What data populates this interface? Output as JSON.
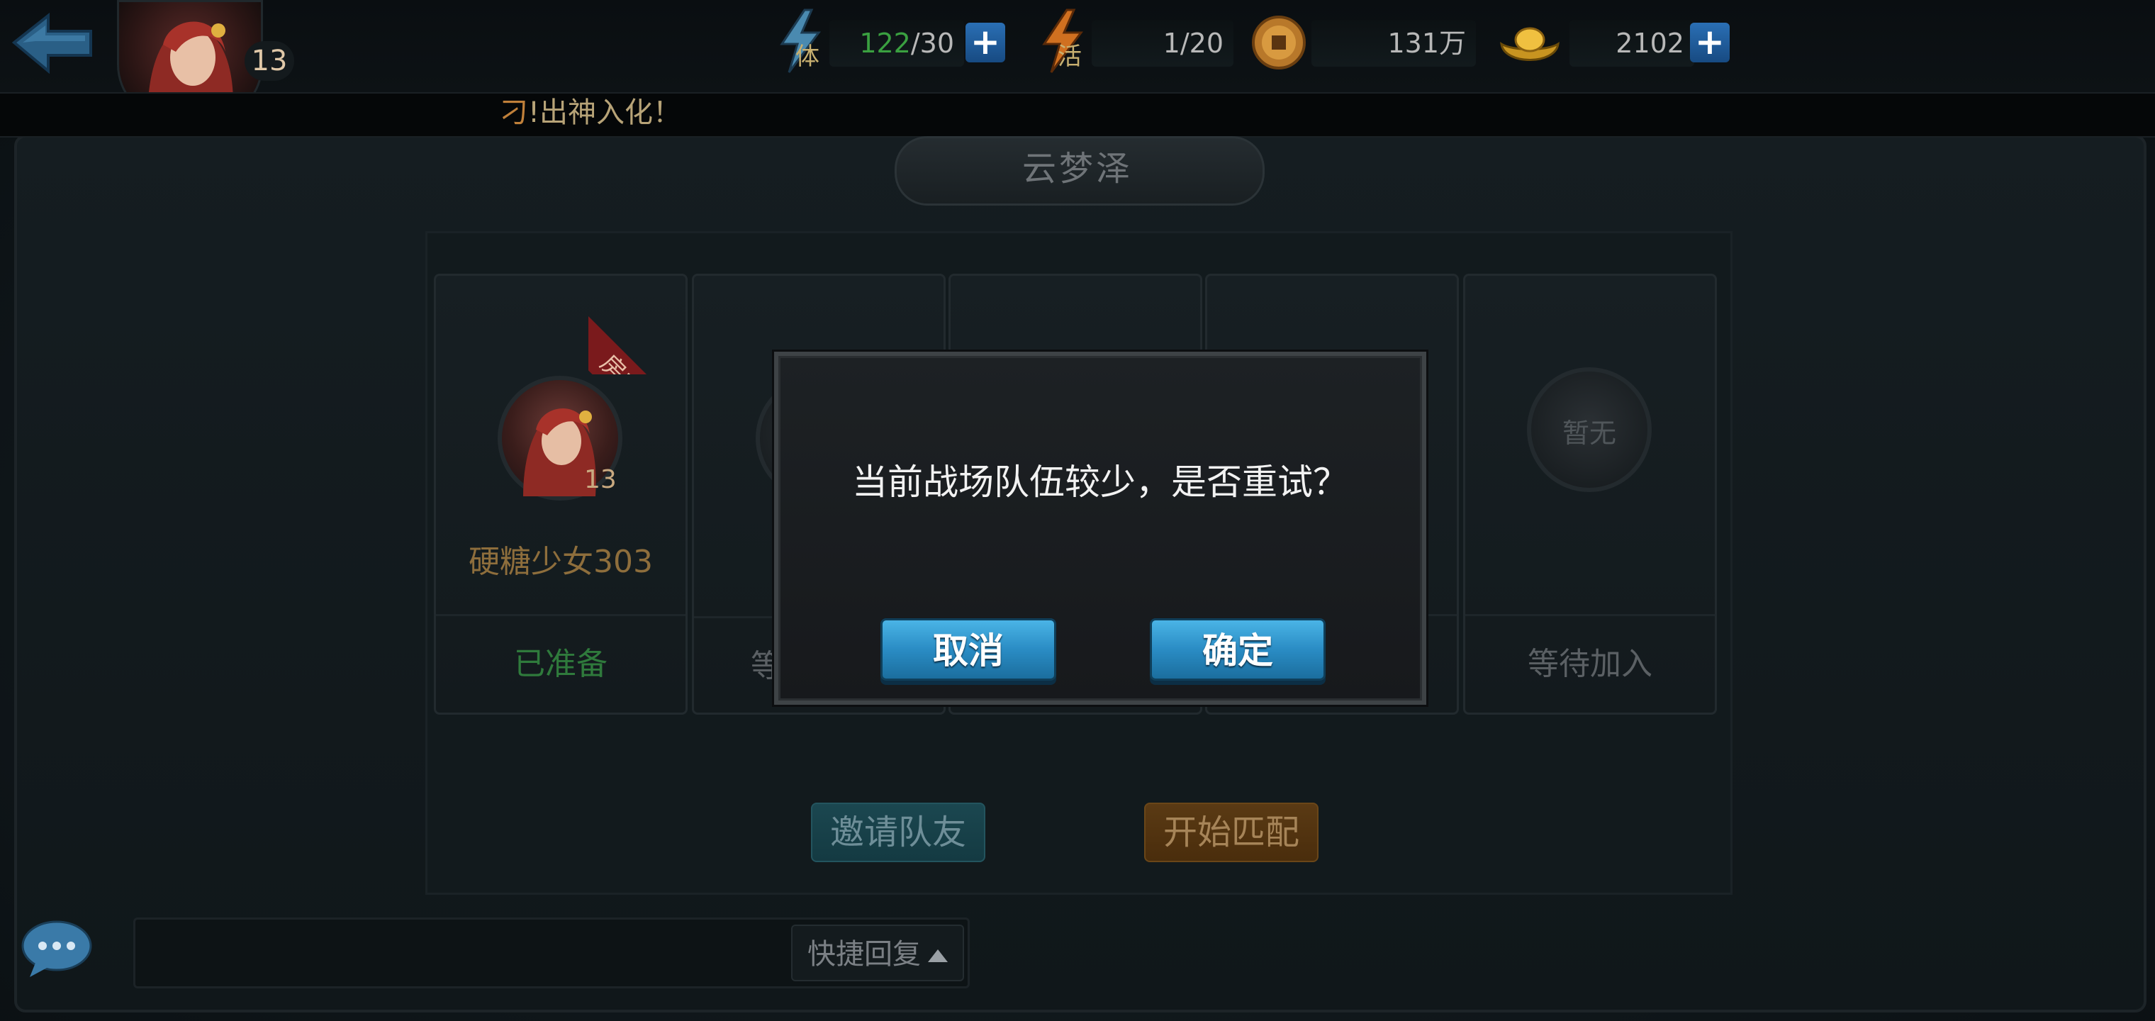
{
  "topbar": {
    "player_level": "13",
    "stamina": {
      "label": "体",
      "current": "122",
      "max": "/30"
    },
    "vitality": {
      "label": "活",
      "value": "1/20"
    },
    "coins": {
      "value": "131万"
    },
    "ingots": {
      "value": "2102"
    },
    "plus_symbol": "+"
  },
  "ticker": {
    "highlight": "刁",
    "text": "!出神入化！"
  },
  "title": "云梦泽",
  "slots": [
    {
      "badge": "房主",
      "level": "13",
      "name": "硬糖少女303",
      "status": "已准备"
    },
    {
      "status": "等"
    },
    {
      "status": ""
    },
    {
      "status": ""
    },
    {
      "avatar_label": "暂无",
      "status": "等待加入"
    }
  ],
  "actions": {
    "invite": "邀请队友",
    "match": "开始匹配"
  },
  "chat": {
    "quick_reply": "快捷回复"
  },
  "modal": {
    "message": "当前战场队伍较少，是否重试？",
    "cancel": "取消",
    "confirm": "确定"
  },
  "colors": {
    "stamina_current": "#3aa040",
    "ready": "#2f7a3c",
    "host_ribbon": "#7a1a1c",
    "modal_button": "#2a8cc4"
  }
}
